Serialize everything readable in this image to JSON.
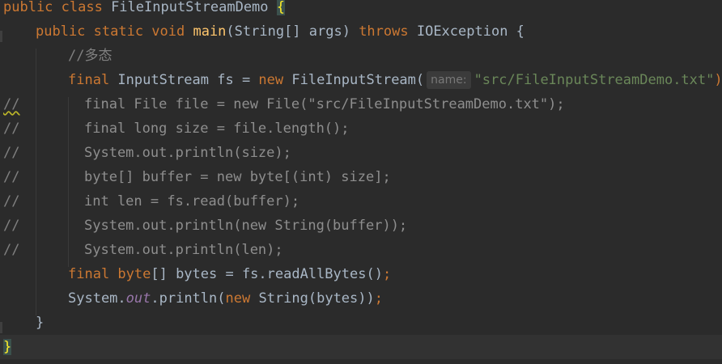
{
  "editor": {
    "lines": [
      {
        "id": "l1",
        "parts": [
          {
            "t": "public class ",
            "c": "kw"
          },
          {
            "t": "FileInputStreamDemo ",
            "c": ""
          },
          {
            "t": "{",
            "c": "brace-hl"
          }
        ]
      },
      {
        "id": "l2",
        "parts": [
          {
            "t": "public static void ",
            "c": "kw"
          },
          {
            "t": "main",
            "c": "fn"
          },
          {
            "t": "(String[] args) ",
            "c": ""
          },
          {
            "t": "throws ",
            "c": "kw"
          },
          {
            "t": "IOException {",
            "c": ""
          }
        ]
      },
      {
        "id": "l3",
        "parts": [
          {
            "t": "//多态",
            "c": "cm"
          }
        ]
      },
      {
        "id": "l4",
        "parts": [
          {
            "t": "final ",
            "c": "kw"
          },
          {
            "t": "InputStream fs = ",
            "c": ""
          },
          {
            "t": "new ",
            "c": "kw"
          },
          {
            "t": "FileInputStream(",
            "c": ""
          },
          {
            "t": "name:",
            "c": "hint"
          },
          {
            "t": "\"src/FileInputStreamDemo.txt\"",
            "c": "str"
          },
          {
            "t": ");",
            "c": "semi"
          }
        ]
      },
      {
        "id": "l5",
        "gutter": "//",
        "parts": [
          {
            "t": "final File file = new File(\"src/FileInputStreamDemo.txt\");",
            "c": "dimmed"
          }
        ]
      },
      {
        "id": "l6",
        "gutter": "//",
        "parts": [
          {
            "t": "final long size = file.length();",
            "c": "dimmed"
          }
        ]
      },
      {
        "id": "l7",
        "gutter": "//",
        "parts": [
          {
            "t": "System.out.println(size);",
            "c": "dimmed"
          }
        ]
      },
      {
        "id": "l8",
        "gutter": "//",
        "parts": [
          {
            "t": "byte[] buffer = new byte[(int) size];",
            "c": "dimmed"
          }
        ]
      },
      {
        "id": "l9",
        "gutter": "//",
        "parts": [
          {
            "t": "int len = fs.read(buffer);",
            "c": "dimmed"
          }
        ]
      },
      {
        "id": "l10",
        "gutter": "//",
        "parts": [
          {
            "t": "System.out.println(new String(buffer));",
            "c": "dimmed"
          }
        ]
      },
      {
        "id": "l11",
        "gutter": "//",
        "parts": [
          {
            "t": "System.out.println(len);",
            "c": "dimmed"
          }
        ]
      },
      {
        "id": "l12",
        "parts": [
          {
            "t": "final byte",
            "c": "kw"
          },
          {
            "t": "[] bytes = fs.readAllBytes()",
            "c": ""
          },
          {
            "t": ";",
            "c": "semi"
          }
        ]
      },
      {
        "id": "l13",
        "parts": [
          {
            "t": "System.",
            "c": ""
          },
          {
            "t": "out",
            "c": "static-field"
          },
          {
            "t": ".println(",
            "c": ""
          },
          {
            "t": "new ",
            "c": "kw"
          },
          {
            "t": "String(bytes))",
            "c": ""
          },
          {
            "t": ";",
            "c": "semi"
          }
        ]
      },
      {
        "id": "l14",
        "parts": [
          {
            "t": "}",
            "c": ""
          }
        ]
      },
      {
        "id": "l15",
        "parts": [
          {
            "t": "}",
            "c": "brace-hl"
          }
        ]
      }
    ]
  },
  "colors": {
    "background": "#2b2b2b",
    "keyword": "#cc7832",
    "method": "#ffc66d",
    "string": "#6a8759",
    "comment": "#808080",
    "text": "#a9b7c6"
  }
}
